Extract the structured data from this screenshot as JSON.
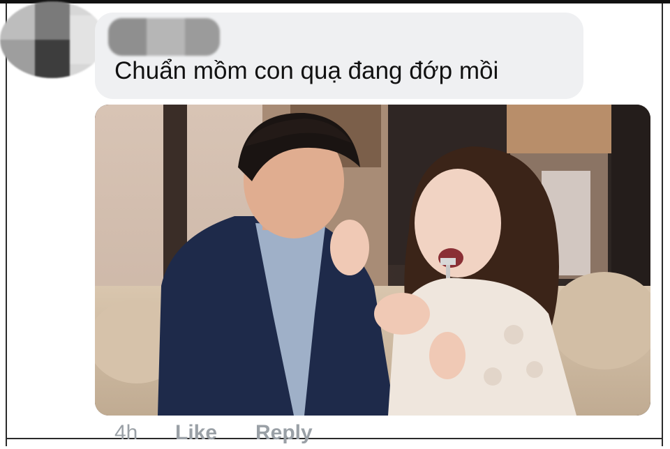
{
  "comment": {
    "author_name": "",
    "text": "Chuẩn mồm con quạ đang đớp mồi",
    "photo_alt": "attached photo"
  },
  "meta": {
    "time": "4h",
    "like_label": "Like",
    "reply_label": "Reply"
  },
  "colors": {
    "bubble_bg": "#eff0f2",
    "meta_text": "#9aa0a6",
    "frame": "#2a2a2a"
  }
}
